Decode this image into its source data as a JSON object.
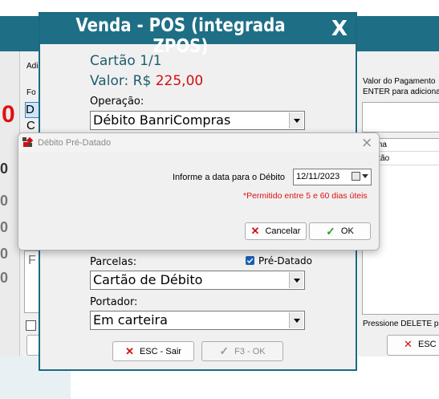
{
  "background": {
    "left_labels": [
      "Adi",
      "Fo"
    ],
    "left_list_items": [
      "D",
      "C"
    ],
    "big_red_value": "0",
    "gray_values": [
      "0",
      "0",
      "0",
      "0",
      "0"
    ],
    "left_bottom_label": "F",
    "right_panel": {
      "label_line1": "Valor do Pagamento",
      "label_line2": "ENTER para adiciona",
      "rows": [
        "ma",
        "rtão"
      ],
      "footer": "Pressione DELETE pa",
      "esc_button": "ESC -"
    }
  },
  "dialog": {
    "title": "Venda - POS (integrada ZPOS)",
    "close_label": "X",
    "card_title": "Cartão 1/1",
    "valor_label": "Valor: R$",
    "valor_value": "225,00",
    "operacao_label": "Operação:",
    "operacao_value": "Débito BanriCompras",
    "parcelas_label": "Parcelas:",
    "pre_datado_label": "Pré-Datado",
    "pre_datado_checked": true,
    "parcelas_value": "Cartão de Débito",
    "portador_label": "Portador:",
    "portador_value": "Em carteira",
    "esc_button": "ESC - Sair",
    "f3_button": "F3 - OK"
  },
  "subdialog": {
    "title": "Débito Pré-Datado",
    "close_label": "×",
    "prompt": "Informe a data para o Débito",
    "date_value": "12/11/2023",
    "note": "*Permitido entre 5 e 60 dias úteis",
    "cancel_button": "Cancelar",
    "ok_button": "OK"
  },
  "colors": {
    "accent": "#1e6f86",
    "value_red": "#d01010",
    "ok_green": "#2da02d"
  }
}
